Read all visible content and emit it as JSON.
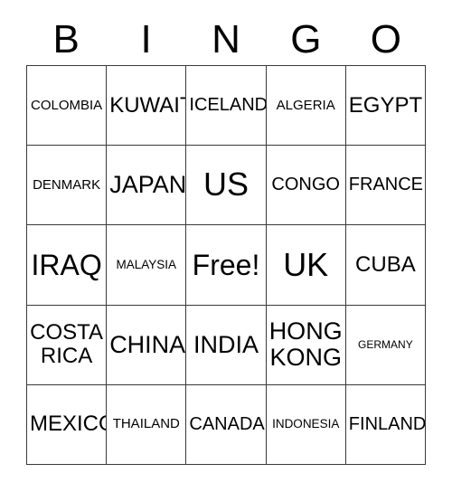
{
  "card": {
    "title": "BINGO",
    "header_letters": [
      "B",
      "I",
      "N",
      "G",
      "O"
    ],
    "free_space_label": "Free!",
    "colors": {
      "background": "#ffffff",
      "text": "#000000",
      "border": "#3a3a3a"
    },
    "columns": [
      {
        "letter": "B",
        "cells": [
          "COLOMBIA",
          "DENMARK",
          "IRAQ",
          "COSTA RICA",
          "MEXICO"
        ]
      },
      {
        "letter": "I",
        "cells": [
          "KUWAIT",
          "JAPAN",
          "MALAYSIA",
          "CHINA",
          "THAILAND"
        ]
      },
      {
        "letter": "N",
        "cells": [
          "ICELAND",
          "US",
          "Free!",
          "INDIA",
          "CANADA"
        ]
      },
      {
        "letter": "G",
        "cells": [
          "ALGERIA",
          "CONGO",
          "UK",
          "HONG KONG",
          "INDONESIA"
        ]
      },
      {
        "letter": "O",
        "cells": [
          "EGYPT",
          "FRANCE",
          "CUBA",
          "GERMANY",
          "FINLAND"
        ]
      }
    ],
    "rows": [
      [
        "COLOMBIA",
        "KUWAIT",
        "ICELAND",
        "ALGERIA",
        "EGYPT"
      ],
      [
        "DENMARK",
        "JAPAN",
        "US",
        "CONGO",
        "FRANCE"
      ],
      [
        "IRAQ",
        "MALAYSIA",
        "Free!",
        "UK",
        "CUBA"
      ],
      [
        "COSTA\nRICA",
        "CHINA",
        "INDIA",
        "HONG\nKONG",
        "GERMANY"
      ],
      [
        "MEXICO",
        "THAILAND",
        "CANADA",
        "INDONESIA",
        "FINLAND"
      ]
    ]
  }
}
